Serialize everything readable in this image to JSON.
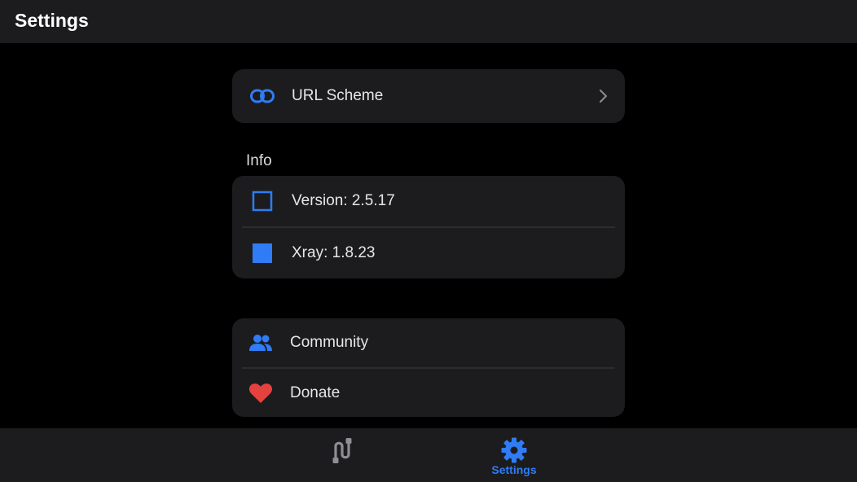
{
  "header": {
    "title": "Settings"
  },
  "url_scheme": {
    "label": "URL Scheme"
  },
  "info": {
    "section_title": "Info",
    "version_label": "Version: 2.5.17",
    "xray_label": "Xray: 1.8.23"
  },
  "links": {
    "community_label": "Community",
    "donate_label": "Donate"
  },
  "tabbar": {
    "tabs": [
      {
        "label": "",
        "icon": "route-icon",
        "active": false
      },
      {
        "label": "Settings",
        "icon": "gear-icon",
        "active": true
      }
    ]
  },
  "colors": {
    "accent": "#2f7cf6",
    "heart": "#e5423f",
    "inactive_icon": "#8e8e93",
    "card_bg": "#1c1c1e"
  }
}
